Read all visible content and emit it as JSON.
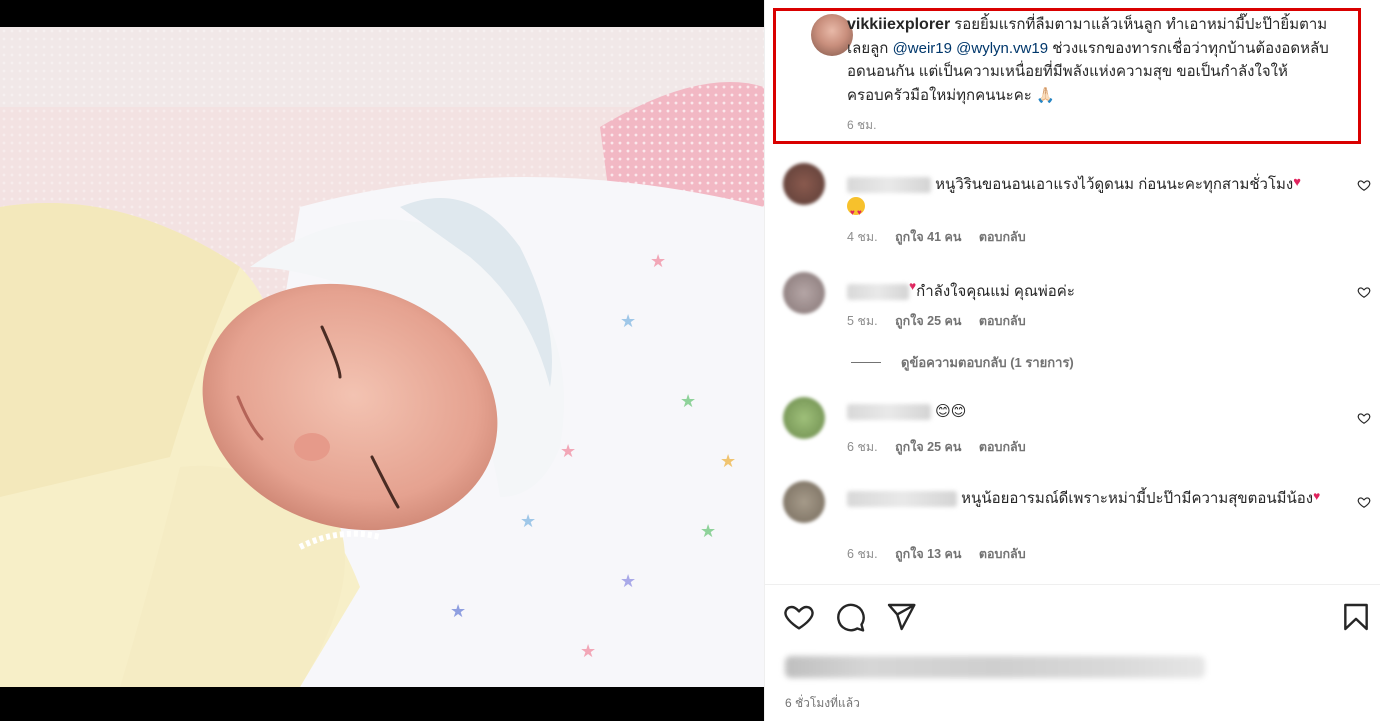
{
  "caption": {
    "username": "vikkiiexplorer",
    "text_part1": "รอยยิ้มแรกที่ลืมตามาแล้วเห็นลูก ทำเอาหม่ามี๊ปะป๊ายิ้มตามเลยลูก ",
    "mention1": "@weir19",
    "mention2": "@wylyn.vw19",
    "text_part2": " ช่วงแรกของทารกเชื่อว่าทุกบ้านต้องอดหลับอดนอนกัน แต่เป็นความเหนื่อยที่มีพลังแห่งความสุข ขอเป็นกำลังใจให้ครอบครัวมือใหม่ทุกคนนะคะ 🙏🏻",
    "time": "6 ชม."
  },
  "comments": [
    {
      "text": "หนูวิรินขอนอนเอาแรงไว้ดูดนม ก่อนนะคะทุกสามชั่วโมง",
      "time": "4 ชม.",
      "likes": "ถูกใจ 41 คน",
      "reply": "ตอบกลับ"
    },
    {
      "text": "กำลังใจคุณแม่ คุณพ่อค่ะ",
      "time": "5 ชม.",
      "likes": "ถูกใจ 25 คน",
      "reply": "ตอบกลับ"
    },
    {
      "text": "😊😊",
      "time": "6 ชม.",
      "likes": "ถูกใจ 25 คน",
      "reply": "ตอบกลับ"
    },
    {
      "text": "หนูน้อยอารมณ์ดีเพราะหม่ามี้ปะป๊ามีความสุขตอนมีน้อง",
      "time": "6 ชม.",
      "likes": "ถูกใจ 13 คน",
      "reply": "ตอบกลับ"
    }
  ],
  "view_replies": "ดูข้อความตอบกลับ (1 รายการ)",
  "post_time": "6 ชั่วโมงที่แล้ว",
  "icons": {
    "like": "heart-icon",
    "comment": "comment-icon",
    "share": "send-icon",
    "save": "bookmark-icon"
  },
  "colors": {
    "highlight_border": "#d90000",
    "mention": "#00376b",
    "heart_emoji": "#e0245e"
  }
}
